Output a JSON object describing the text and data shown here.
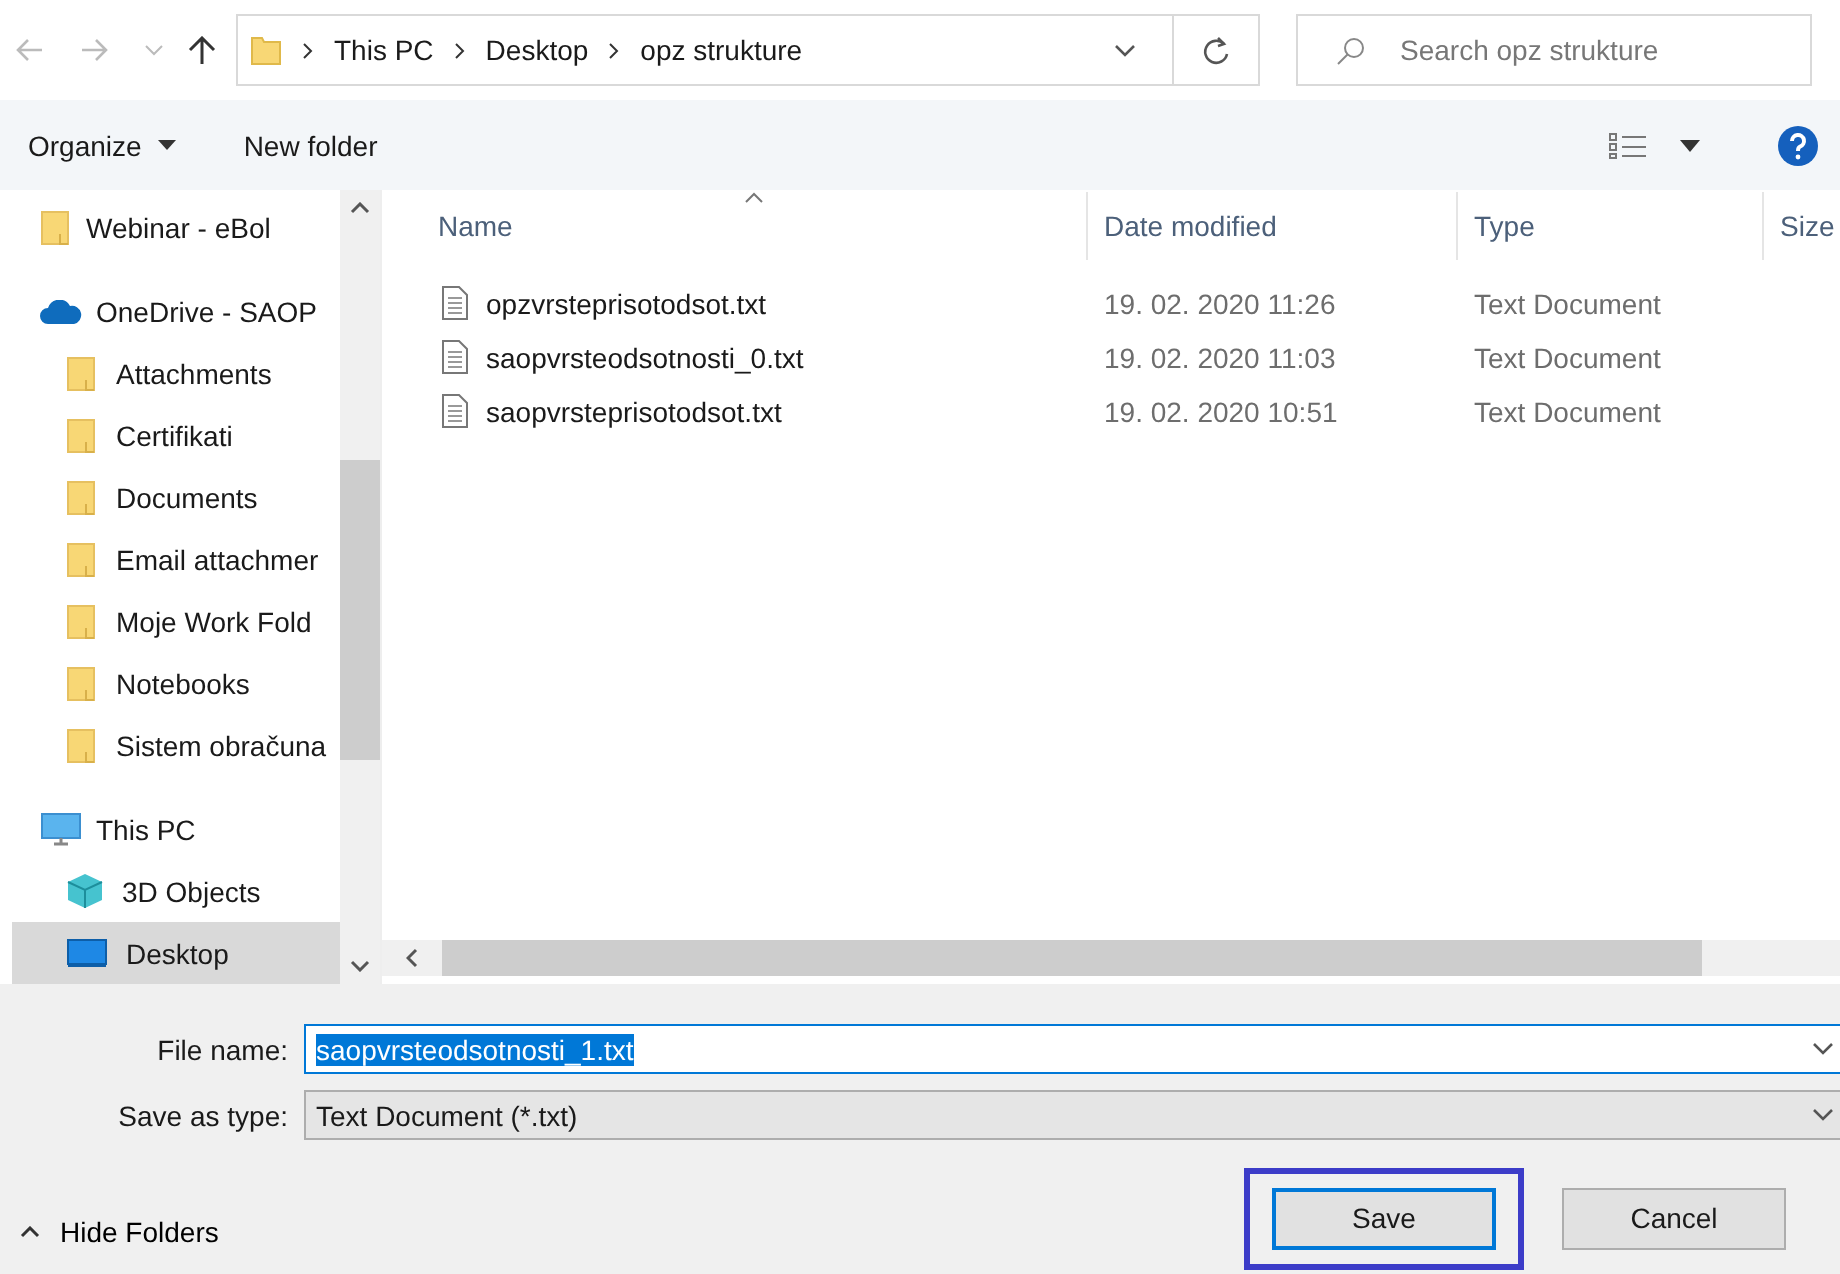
{
  "address_bar": {
    "breadcrumbs": [
      "This PC",
      "Desktop",
      "opz strukture"
    ]
  },
  "search": {
    "placeholder": "Search opz strukture"
  },
  "toolbar": {
    "organize": "Organize",
    "new_folder": "New folder"
  },
  "sidebar": {
    "items": [
      {
        "label": "Webinar - eBol",
        "kind": "folder",
        "selected": false
      },
      {
        "label": "OneDrive - SAOP",
        "kind": "cloud",
        "selected": false,
        "children": [
          {
            "label": "Attachments",
            "kind": "folder",
            "selected": false
          },
          {
            "label": "Certifikati",
            "kind": "folder",
            "selected": false
          },
          {
            "label": "Documents",
            "kind": "folder",
            "selected": false
          },
          {
            "label": "Email attachmer",
            "kind": "folder",
            "selected": false
          },
          {
            "label": "Moje Work Fold",
            "kind": "folder",
            "selected": false
          },
          {
            "label": "Notebooks",
            "kind": "folder",
            "selected": false
          },
          {
            "label": "Sistem obračuna",
            "kind": "folder",
            "selected": false
          }
        ]
      },
      {
        "label": "This PC",
        "kind": "pc",
        "selected": false,
        "children": [
          {
            "label": "3D Objects",
            "kind": "cube",
            "selected": false
          },
          {
            "label": "Desktop",
            "kind": "desktop",
            "selected": true
          }
        ]
      }
    ]
  },
  "file_list": {
    "columns": [
      "Name",
      "Date modified",
      "Type",
      "Size"
    ],
    "rows": [
      {
        "name": "opzvrsteprisotodsot.txt",
        "date": "19. 02. 2020 11:26",
        "type": "Text Document"
      },
      {
        "name": "saopvrsteodsotnosti_0.txt",
        "date": "19. 02. 2020 11:03",
        "type": "Text Document"
      },
      {
        "name": "saopvrsteprisotodsot.txt",
        "date": "19. 02. 2020 10:51",
        "type": "Text Document"
      }
    ]
  },
  "form": {
    "file_name_label": "File name:",
    "file_name": "saopvrsteodsotnosti_1.txt",
    "file_name_selected": true,
    "save_type_label": "Save as type:",
    "save_type": "Text Document (*.txt)"
  },
  "hide_folders": "Hide Folders",
  "buttons": [
    {
      "label": "Save",
      "highlighted": true
    },
    {
      "label": "Cancel",
      "highlighted": false
    }
  ]
}
